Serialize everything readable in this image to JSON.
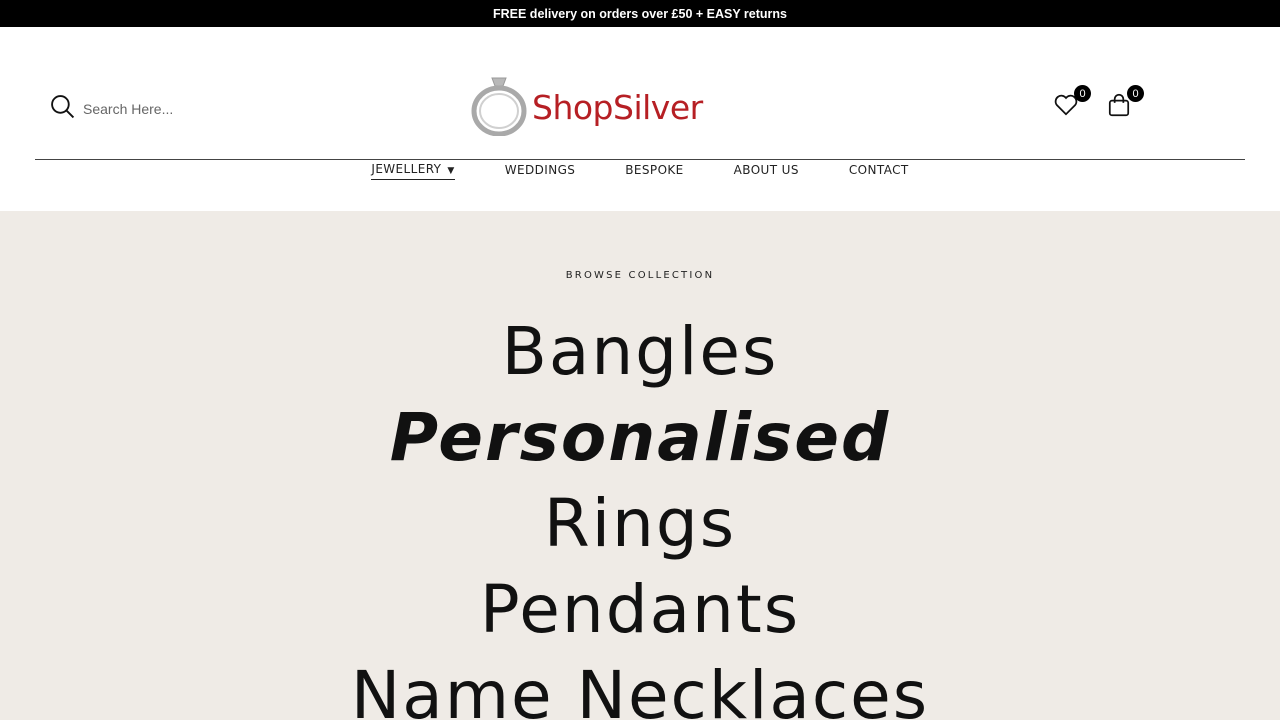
{
  "announcement": "FREE delivery on orders over £50 + EASY returns",
  "search": {
    "placeholder": "Search Here..."
  },
  "logo": {
    "text": "ShopSilver",
    "brand_color": "#b61f24"
  },
  "wishlist": {
    "count": "0"
  },
  "cart": {
    "count": "0"
  },
  "nav": {
    "items": [
      {
        "label": "JEWELLERY",
        "active": true,
        "has_dropdown": true
      },
      {
        "label": "WEDDINGS"
      },
      {
        "label": "BESPOKE"
      },
      {
        "label": "ABOUT US"
      },
      {
        "label": "CONTACT"
      }
    ]
  },
  "hero": {
    "eyebrow": "BROWSE COLLECTION",
    "collections": [
      "Bangles",
      "Personalised",
      "Rings",
      "Pendants",
      "Name Necklaces"
    ],
    "background": "#efebe6"
  }
}
